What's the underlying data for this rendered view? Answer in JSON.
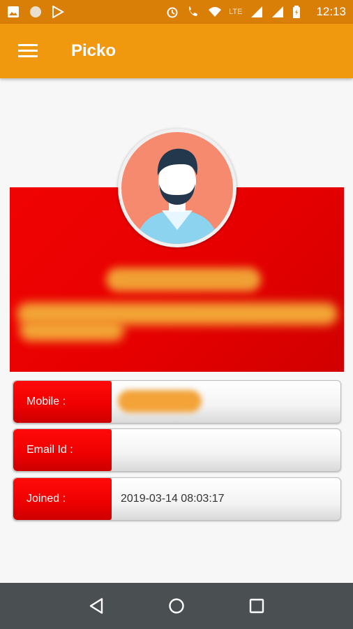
{
  "status_bar": {
    "time": "12:13",
    "network_label": "LTE",
    "network_label_2": "LTE"
  },
  "app_bar": {
    "title": "Picko"
  },
  "profile": {
    "avatar": "avatar-icon"
  },
  "details": [
    {
      "label": "Mobile :",
      "value": ""
    },
    {
      "label": "Email Id :",
      "value": ""
    },
    {
      "label": "Joined :",
      "value": "2019-03-14 08:03:17"
    }
  ],
  "colors": {
    "status_bar": "#d97f07",
    "app_bar": "#f0980e",
    "panel_red": "#e60000",
    "nav_bar": "#4a4f52"
  }
}
